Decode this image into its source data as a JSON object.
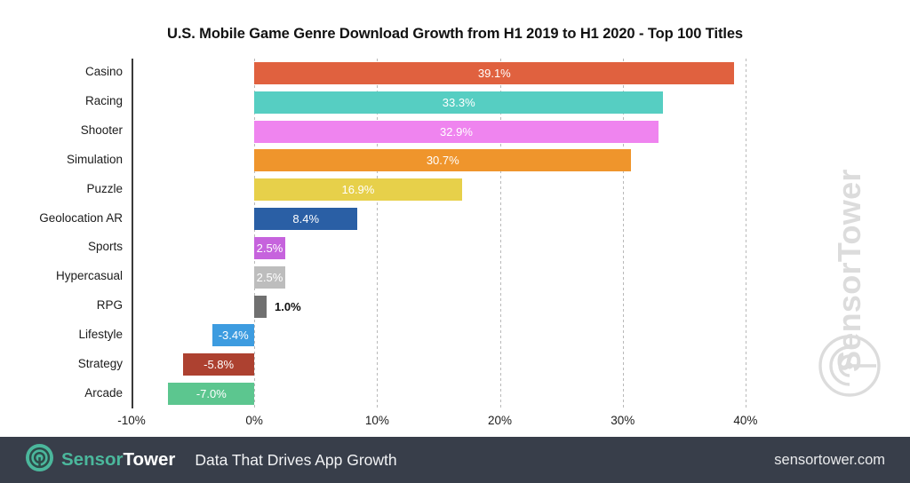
{
  "chart_data": {
    "type": "bar",
    "orientation": "horizontal",
    "title": "U.S. Mobile Game Genre Download Growth from H1 2019 to H1 2020 - Top 100 Titles",
    "xlabel": "",
    "ylabel": "",
    "xlim": [
      -10,
      45
    ],
    "xticks": [
      "-10%",
      "0%",
      "10%",
      "20%",
      "30%",
      "40%"
    ],
    "xtick_values": [
      -10,
      0,
      10,
      20,
      30,
      40
    ],
    "grid": "vertical-dotted",
    "legend": "none",
    "categories": [
      "Casino",
      "Racing",
      "Shooter",
      "Simulation",
      "Puzzle",
      "Geolocation AR",
      "Sports",
      "Hypercasual",
      "RPG",
      "Lifestyle",
      "Strategy",
      "Arcade"
    ],
    "values": [
      39.1,
      33.3,
      32.9,
      30.7,
      16.9,
      8.4,
      2.5,
      2.5,
      1.0,
      -3.4,
      -5.8,
      -7.0
    ],
    "data_labels": [
      "39.1%",
      "33.3%",
      "32.9%",
      "30.7%",
      "16.9%",
      "8.4%",
      "2.5%",
      "2.5%",
      "1.0%",
      "-3.4%",
      "-5.8%",
      "-7.0%"
    ],
    "colors": [
      "#e0613f",
      "#56cec2",
      "#ef84ef",
      "#ef952c",
      "#e7d04a",
      "#2a5fa5",
      "#c martian",
      "#bdbdbd",
      "#707070",
      "#3d9ce0",
      "#ad4130",
      "#5cc68f"
    ],
    "bar_colors": [
      "#e0613f",
      "#56cec2",
      "#ef84ef",
      "#ef952c",
      "#e7d04a",
      "#2a5fa5",
      "#c663dd",
      "#bdbdbd",
      "#707070",
      "#3d9ce0",
      "#ad4130",
      "#5cc68f"
    ],
    "label_placement": [
      "inside",
      "inside",
      "inside",
      "inside",
      "inside",
      "inside",
      "inside",
      "inside",
      "outside",
      "inside",
      "inside",
      "inside"
    ]
  },
  "watermark": {
    "brand_sensor": "Sensor",
    "brand_tower": "Tower",
    "full": "SensorTower"
  },
  "footer": {
    "brand_sensor": "Sensor",
    "brand_tower": "Tower",
    "tagline": "Data That Drives App Growth",
    "url": "sensortower.com",
    "background": "#383e4a",
    "accent": "#4bb79c"
  }
}
